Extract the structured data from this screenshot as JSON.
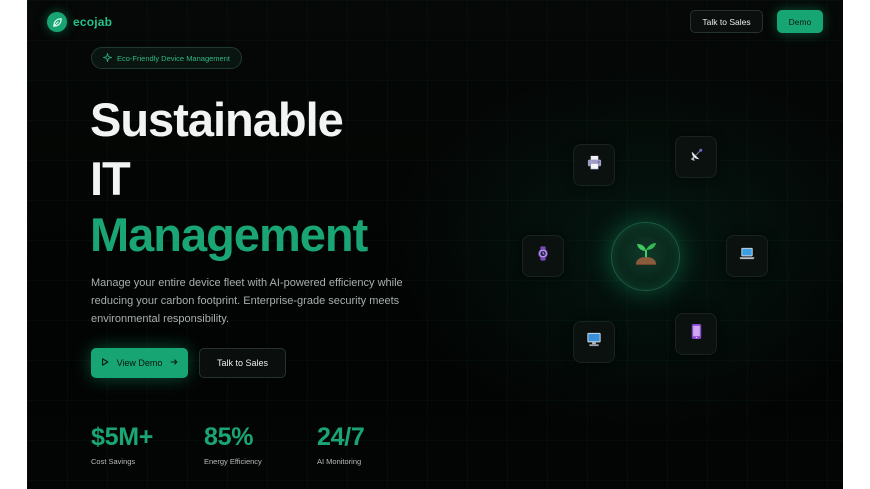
{
  "nav": {
    "logo_text": "ecojab",
    "talk_to_sales": "Talk to Sales",
    "demo": "Demo"
  },
  "hero": {
    "badge": "Eco-Friendly Device Management",
    "title_line1": "Sustainable",
    "title_line2": "IT",
    "title_line3": "Management",
    "description": "Manage your entire device fleet with AI-powered efficiency while reducing your carbon footprint. Enterprise-grade security meets environmental responsibility.",
    "view_demo": "View Demo",
    "talk_to_sales": "Talk to Sales"
  },
  "stats": [
    {
      "value": "$5M+",
      "label": "Cost Savings"
    },
    {
      "value": "85%",
      "label": "Energy Efficiency"
    },
    {
      "value": "24/7",
      "label": "AI Monitoring"
    }
  ],
  "graphic": {
    "center_icon": "seedling-icon",
    "devices": [
      "printer-icon",
      "satellite-dish-icon",
      "laptop-icon",
      "tablet-icon",
      "desktop-monitor-icon",
      "smartwatch-icon"
    ]
  },
  "colors": {
    "accent": "#17a673",
    "accent_text": "#1aa674",
    "background": "#030504",
    "heading": "#f2f4f3"
  }
}
